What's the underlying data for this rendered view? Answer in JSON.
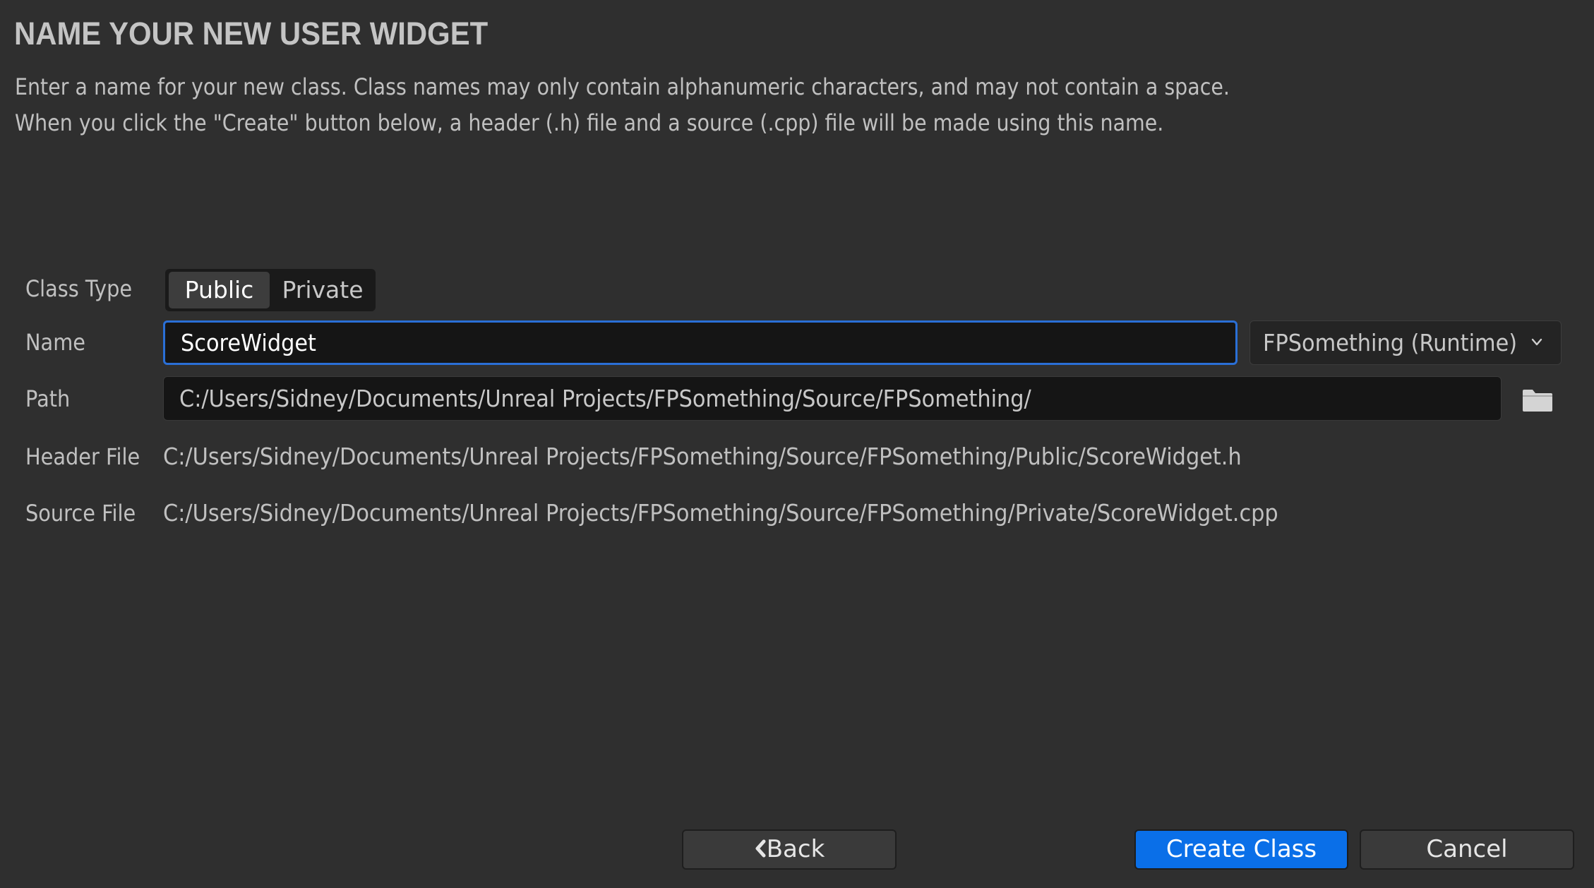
{
  "header": {
    "title": "NAME YOUR NEW USER WIDGET",
    "description_line1": "Enter a name for your new class. Class names may only contain alphanumeric characters, and may not contain a space.",
    "description_line2": "When you click the \"Create\" button below, a header (.h) file and a source (.cpp) file will be made using this name."
  },
  "form": {
    "class_type": {
      "label": "Class Type",
      "options": [
        "Public",
        "Private"
      ],
      "selected": "Public"
    },
    "name": {
      "label": "Name",
      "value": "ScoreWidget"
    },
    "module": {
      "selected": "FPSomething (Runtime)",
      "icon": "chevron-down-icon"
    },
    "path": {
      "label": "Path",
      "value": "C:/Users/Sidney/Documents/Unreal Projects/FPSomething/Source/FPSomething/",
      "browse_icon": "folder-icon"
    },
    "header_file": {
      "label": "Header File",
      "value": "C:/Users/Sidney/Documents/Unreal Projects/FPSomething/Source/FPSomething/Public/ScoreWidget.h"
    },
    "source_file": {
      "label": "Source File",
      "value": "C:/Users/Sidney/Documents/Unreal Projects/FPSomething/Source/FPSomething/Private/ScoreWidget.cpp"
    }
  },
  "footer": {
    "back_label": "Back",
    "back_icon": "chevron-left-icon",
    "create_label": "Create Class",
    "cancel_label": "Cancel"
  },
  "colors": {
    "background": "#2f2f2f",
    "primary_button": "#0a6fe8",
    "focus_border": "#2a6fd6"
  }
}
